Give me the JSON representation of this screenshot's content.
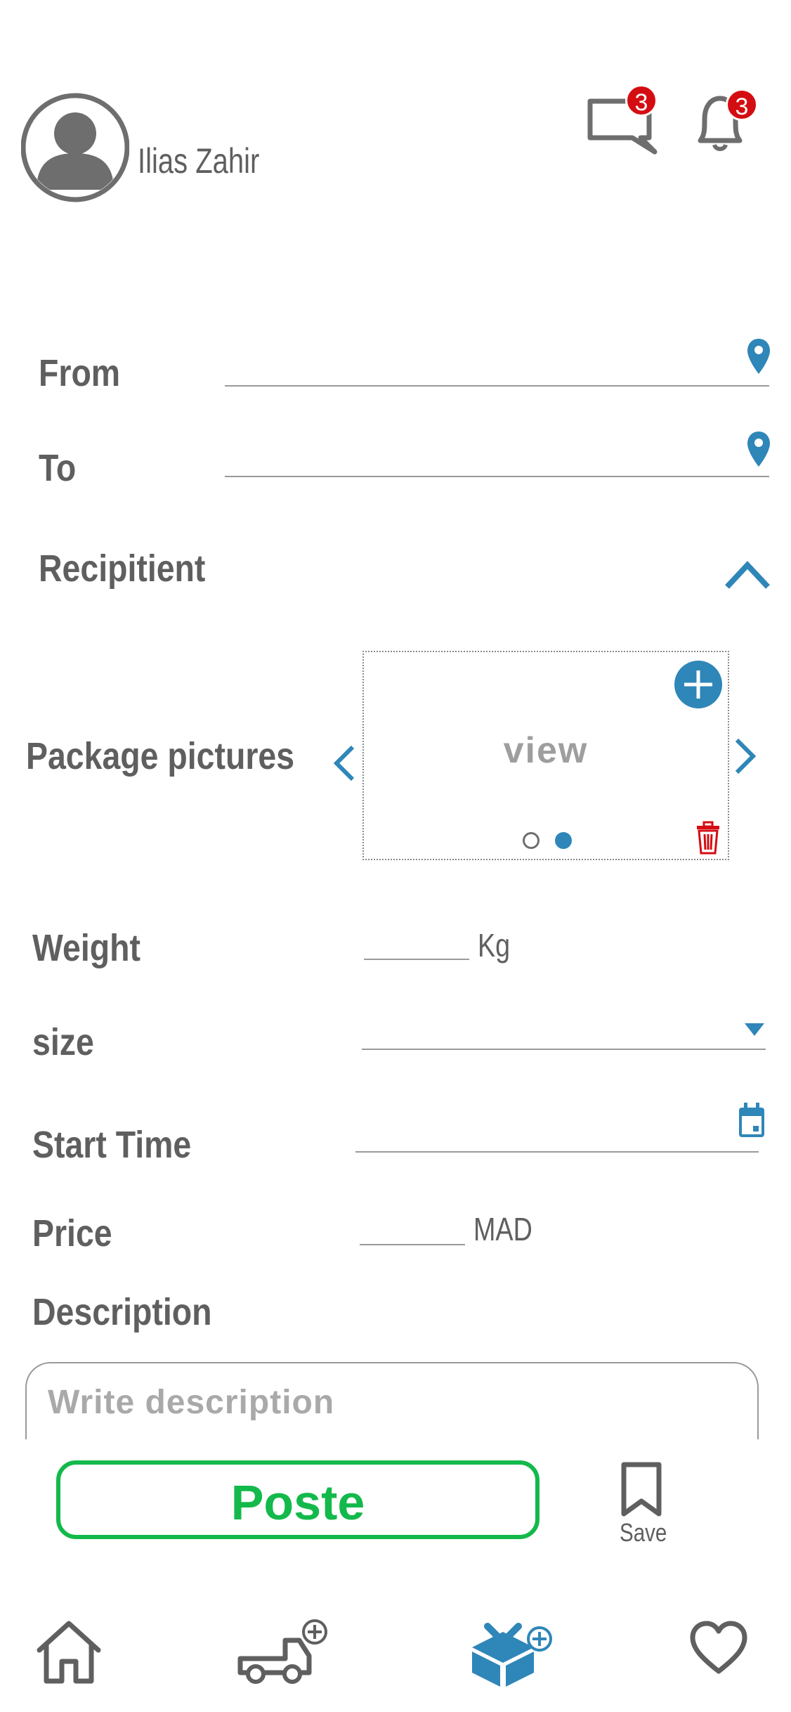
{
  "user": {
    "name": "Ilias Zahir"
  },
  "header": {
    "messages_count": "3",
    "notifications_count": "3"
  },
  "form": {
    "from_label": "From",
    "to_label": "To",
    "recipient_label": "Recipitient",
    "pictures_label": "Package pictures",
    "view_text": "view",
    "weight_label": "Weight",
    "weight_unit": "Kg",
    "size_label": "size",
    "start_time_label": "Start Time",
    "price_label": "Price",
    "price_unit": "MAD",
    "description_label": "Description",
    "description_placeholder": "Write description",
    "carousel_pages": 2,
    "carousel_active": 2
  },
  "actions": {
    "post_label": "Poste",
    "save_label": "Save"
  },
  "colors": {
    "accent": "#2f86b8",
    "post_green": "#13b94b",
    "danger": "#d40d12",
    "text": "#5f5f5f"
  },
  "icons": [
    "avatar-icon",
    "chat-icon",
    "bell-icon",
    "location-pin-icon",
    "chevron-up-icon",
    "chevron-left-icon",
    "chevron-right-icon",
    "add-icon",
    "trash-icon",
    "dropdown-arrow-icon",
    "calendar-icon",
    "bookmark-icon",
    "home-icon",
    "truck-add-icon",
    "package-add-icon",
    "heart-icon"
  ]
}
